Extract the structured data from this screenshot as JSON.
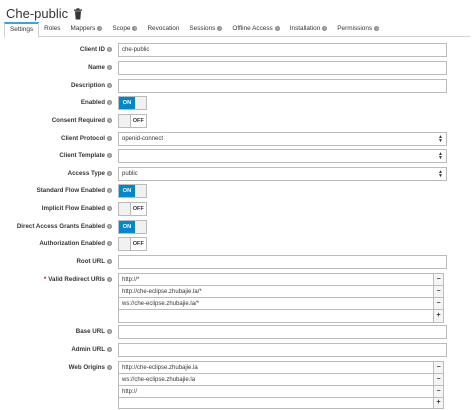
{
  "header": {
    "title": "Che-public",
    "delete_icon": "trash-icon"
  },
  "tabs": [
    {
      "label": "Settings",
      "help": false,
      "active": true
    },
    {
      "label": "Roles",
      "help": false
    },
    {
      "label": "Mappers",
      "help": true
    },
    {
      "label": "Scope",
      "help": true
    },
    {
      "label": "Revocation",
      "help": false
    },
    {
      "label": "Sessions",
      "help": true
    },
    {
      "label": "Offline Access",
      "help": true
    },
    {
      "label": "Installation",
      "help": true
    },
    {
      "label": "Permissions",
      "help": true
    }
  ],
  "form": {
    "client_id": {
      "label": "Client ID",
      "value": "che-public"
    },
    "name": {
      "label": "Name",
      "value": ""
    },
    "description": {
      "label": "Description",
      "value": ""
    },
    "enabled": {
      "label": "Enabled",
      "state": "ON"
    },
    "consent_required": {
      "label": "Consent Required",
      "state": "OFF"
    },
    "client_protocol": {
      "label": "Client Protocol",
      "value": "openid-connect"
    },
    "client_template": {
      "label": "Client Template",
      "value": ""
    },
    "access_type": {
      "label": "Access Type",
      "value": "public"
    },
    "standard_flow": {
      "label": "Standard Flow Enabled",
      "state": "ON"
    },
    "implicit_flow": {
      "label": "Implicit Flow Enabled",
      "state": "OFF"
    },
    "direct_access": {
      "label": "Direct Access Grants Enabled",
      "state": "ON"
    },
    "authorization": {
      "label": "Authorization Enabled",
      "state": "OFF"
    },
    "root_url": {
      "label": "Root URL",
      "value": ""
    },
    "redirect_uris": {
      "label": "Valid Redirect URIs",
      "required_mark": "*",
      "values": [
        "http://*",
        "http://che-eclipse.zhubajie.la/*",
        "ws://che-eclipse.zhubajie.la/*",
        ""
      ]
    },
    "base_url": {
      "label": "Base URL",
      "value": ""
    },
    "admin_url": {
      "label": "Admin URL",
      "value": ""
    },
    "web_origins": {
      "label": "Web Origins",
      "values": [
        "http://che-eclipse.zhubajie.la",
        "ws://che-eclipse.zhubajie.la",
        "http://",
        ""
      ]
    }
  },
  "buttons": {
    "minus": "−",
    "plus": "+",
    "toggle_on": "ON",
    "toggle_off": "OFF"
  },
  "colors": {
    "accent": "#0088ce",
    "tab_active_border": "#39a5dc"
  }
}
